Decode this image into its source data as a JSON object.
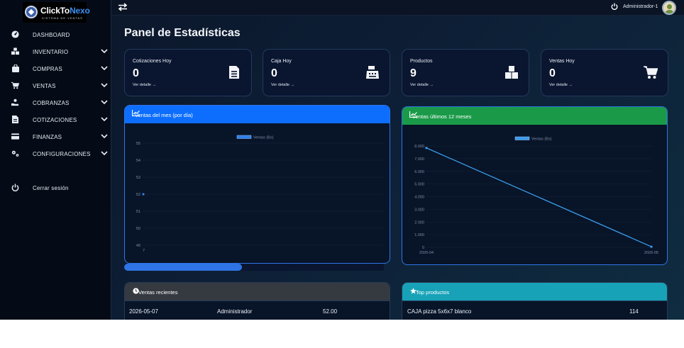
{
  "brand": {
    "name_part1": "ClickTo",
    "name_part2": "Nexo",
    "tagline": "SISTEMA DE VENTAS"
  },
  "sidebar": {
    "items": [
      {
        "label": "DASHBOARD",
        "icon": "dashboard-icon",
        "has_submenu": false
      },
      {
        "label": "INVENTARIO",
        "icon": "boxes-icon",
        "has_submenu": true
      },
      {
        "label": "COMPRAS",
        "icon": "shopping-bag-icon",
        "has_submenu": true
      },
      {
        "label": "VENTAS",
        "icon": "cart-icon",
        "has_submenu": true
      },
      {
        "label": "COBRANZAS",
        "icon": "hand-money-icon",
        "has_submenu": true
      },
      {
        "label": "COTIZACIONES",
        "icon": "invoice-icon",
        "has_submenu": true
      },
      {
        "label": "FINANZAS",
        "icon": "credit-card-icon",
        "has_submenu": true
      },
      {
        "label": "CONFIGURACIONES",
        "icon": "gears-icon",
        "has_submenu": true
      }
    ],
    "logout_label": "Cerrar sesión"
  },
  "topbar": {
    "user_label": "Administrador-1"
  },
  "page": {
    "title": "Panel de Estadísticas"
  },
  "cards": [
    {
      "title": "Cotizaciones Hoy",
      "value": "0",
      "link": "Ver detalle →",
      "icon": "invoice-icon"
    },
    {
      "title": "Caja Hoy",
      "value": "0",
      "link": "Ver detalle →",
      "icon": "cash-register-icon"
    },
    {
      "title": "Productos",
      "value": "9",
      "link": "Ver detalle →",
      "icon": "boxes-icon"
    },
    {
      "title": "Ventas Hoy",
      "value": "0",
      "link": "Ver detalle →",
      "icon": "cart-icon"
    }
  ],
  "panels": {
    "daily": {
      "title": "Ventas del mes (por día)",
      "color": "#0d6efd"
    },
    "monthly": {
      "title": "Ventas últimos 12 meses",
      "color": "#1a9a48"
    },
    "recent": {
      "title": "Ventas recientes",
      "color": "#343a40"
    },
    "top": {
      "title": "Top productos",
      "color": "#17a2b8"
    }
  },
  "recent_sales": [
    {
      "date": "2026-05-07",
      "user": "Administrador",
      "amount": "52.00"
    }
  ],
  "top_products": [
    {
      "name": "CAJA pizza 5x6x7 blanco",
      "qty": "114"
    }
  ],
  "chart_data": [
    {
      "type": "line",
      "title": "Ventas del mes (por día)",
      "series": [
        {
          "name": "Ventas (Bs)",
          "x": [
            "7"
          ],
          "values": [
            52
          ]
        }
      ],
      "x": [
        "7"
      ],
      "yticks": [
        "55",
        "54",
        "53",
        "52",
        "51",
        "50",
        "49"
      ],
      "ylim": [
        49,
        55
      ],
      "grid": true,
      "legend": "top-center",
      "color": "#2f7fe8"
    },
    {
      "type": "line",
      "title": "Ventas últimos 12 meses",
      "series": [
        {
          "name": "Ventas (Bs)",
          "x": [
            "2026-04",
            "2026-05"
          ],
          "values": [
            7845,
            52
          ]
        }
      ],
      "x": [
        "2026-04",
        "2026-05"
      ],
      "yticks": [
        "8.000",
        "7.000",
        "6.000",
        "5.000",
        "4.000",
        "3.000",
        "2.000",
        "1.000",
        "0"
      ],
      "ylim": [
        0,
        8000
      ],
      "grid": true,
      "legend": "top-center",
      "color": "#3a9be8"
    }
  ]
}
